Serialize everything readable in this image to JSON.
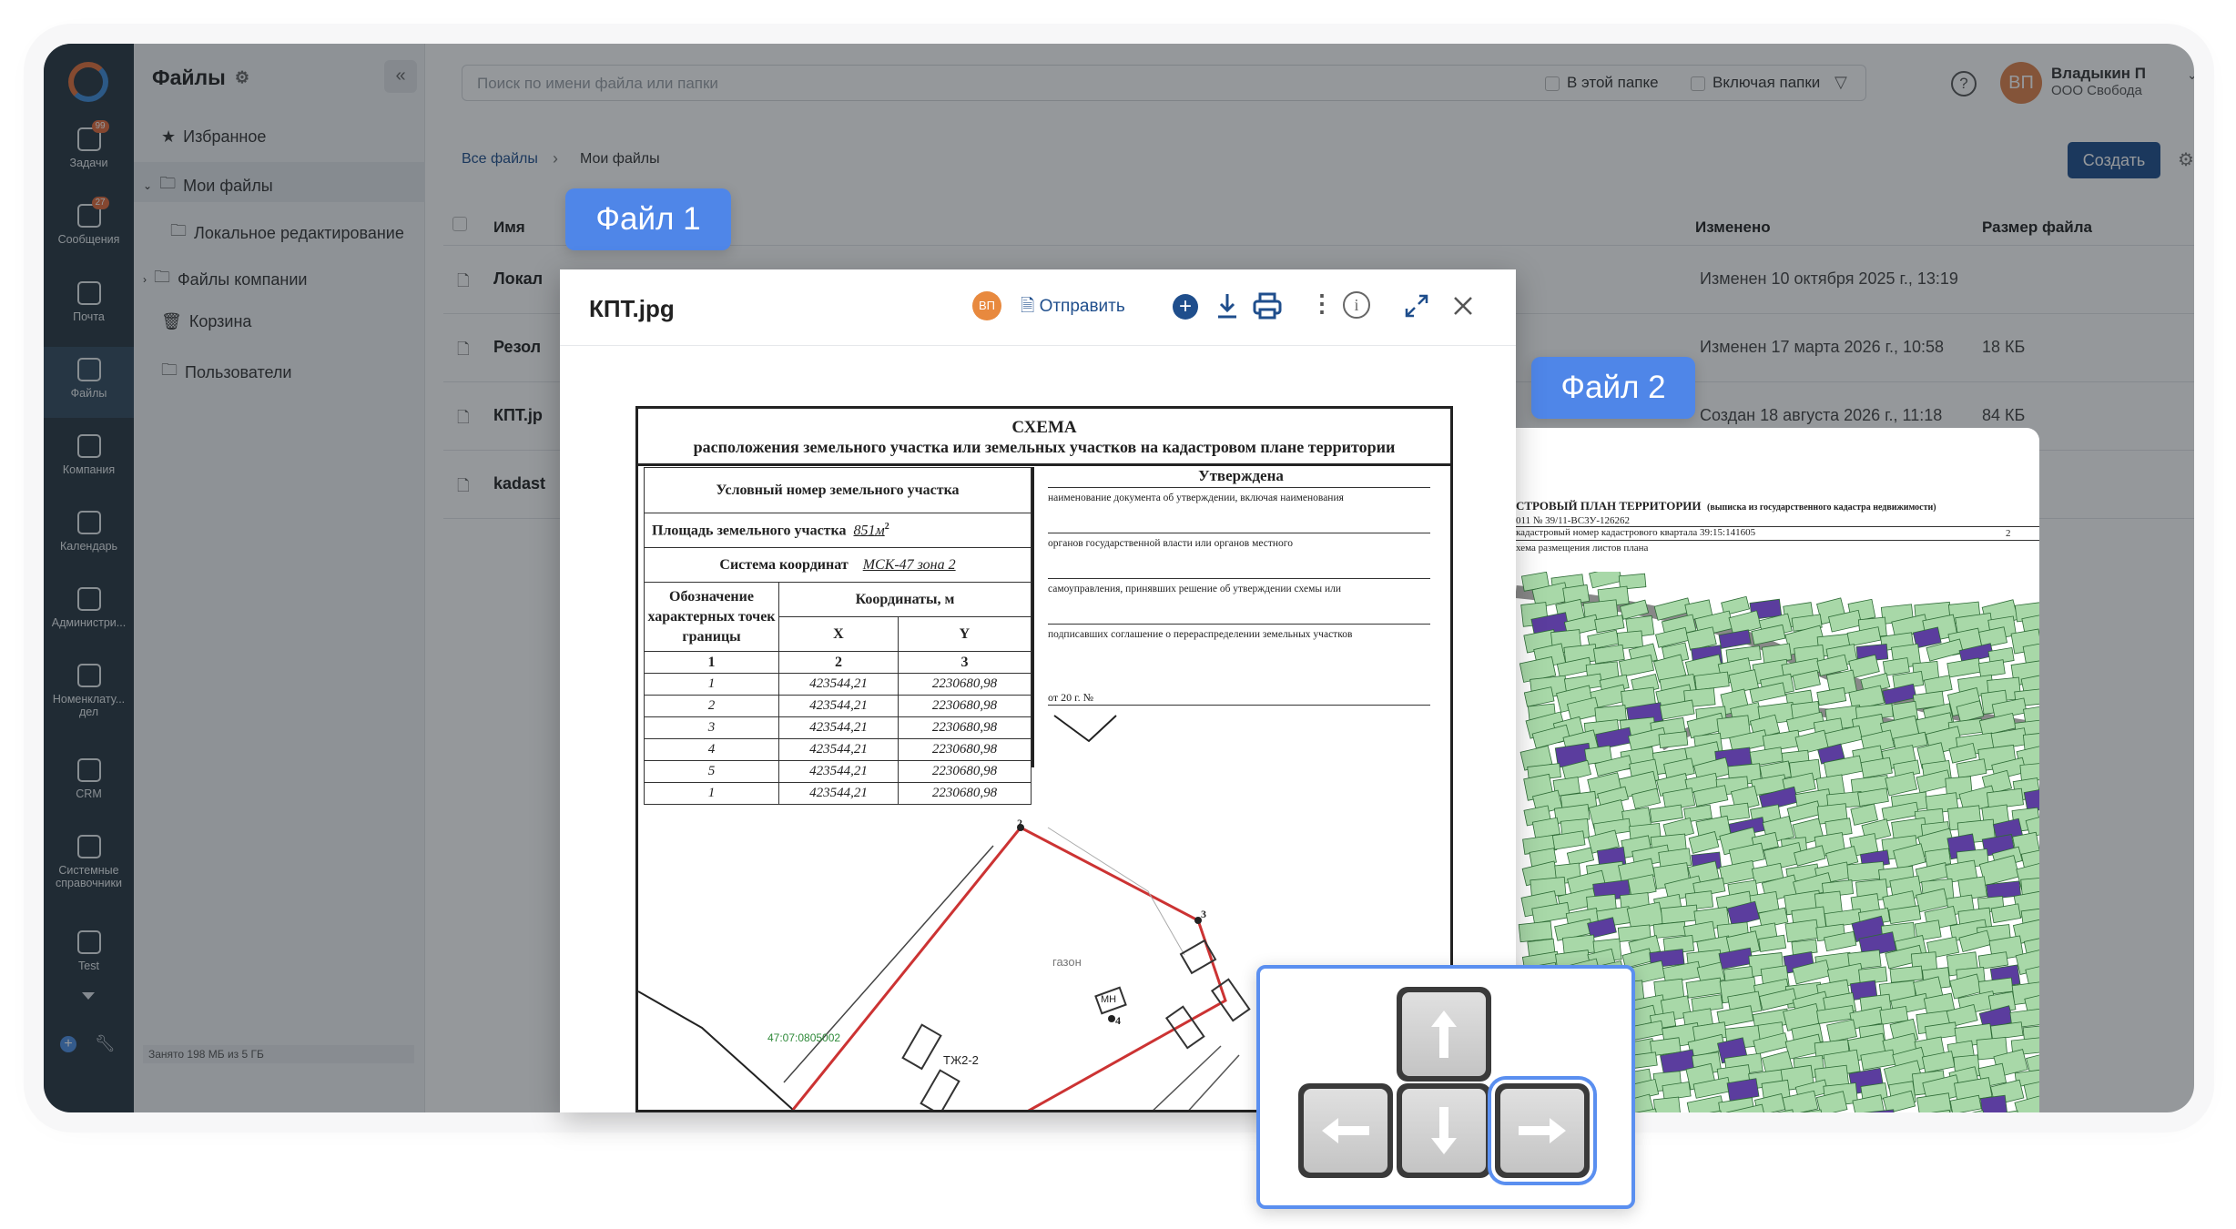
{
  "sidebar": {
    "items": [
      {
        "label": "Задачи",
        "badge": "99",
        "icon": "tasks-icon"
      },
      {
        "label": "Сообщения",
        "badge": "27",
        "icon": "messages-icon"
      },
      {
        "label": "Почта",
        "icon": "at-icon"
      },
      {
        "label": "Файлы",
        "icon": "file-icon"
      },
      {
        "label": "Компания",
        "icon": "company-icon"
      },
      {
        "label": "Календарь",
        "icon": "calendar-icon"
      },
      {
        "label": "Администри...",
        "icon": "gear-icon"
      },
      {
        "label": "Номенклату... дел",
        "icon": "document-icon"
      },
      {
        "label": "CRM",
        "icon": "contact-icon"
      },
      {
        "label": "Системные справочники",
        "icon": "document-icon"
      },
      {
        "label": "Test",
        "icon": "notebook-icon"
      }
    ]
  },
  "tree": {
    "title": "Файлы",
    "items": [
      "Избранное",
      "Мои файлы",
      "Локальное редактирование",
      "Файлы компании",
      "Корзина",
      "Пользователи"
    ],
    "storage": "Занято 198 МБ из 5 ГБ"
  },
  "header": {
    "search_placeholder": "Поиск по имени файла или папки",
    "in_folder": "В этой папке",
    "include_folders": "Включая папки",
    "user_initials": "ВП",
    "user_name": "Владыкин П",
    "user_org": "ООО Свобода"
  },
  "breadcrumb": {
    "root": "Все файлы",
    "current": "Мои файлы"
  },
  "create_label": "Создать",
  "table": {
    "columns": {
      "name": "Имя",
      "modified": "Изменено",
      "size": "Размер файла"
    },
    "rows": [
      {
        "name": "Локал",
        "modified": "Изменен 10 октября 2025 г., 13:19",
        "size": ""
      },
      {
        "name": "Резол",
        "modified": "Изменен 17 марта 2026 г., 10:58",
        "size": "18 КБ"
      },
      {
        "name": "КПТ.jp",
        "modified": "Создан 18 августа 2026 г., 11:18",
        "size": "84 КБ"
      },
      {
        "name": "kadast",
        "modified": "",
        "size": ""
      }
    ]
  },
  "callouts": {
    "file1": "Файл 1",
    "file2": "Файл 2"
  },
  "viewer": {
    "filename": "КПТ.jpg",
    "avatar": "ВП",
    "send_label": "Отправить"
  },
  "doc": {
    "title": "СХЕМА",
    "subtitle": "расположения земельного участка или земельных участков на кадастровом плане территории",
    "parcel_number_label": "Условный номер земельного участка",
    "area_label": "Площадь земельного участка",
    "area_value": "851м",
    "coord_system_label": "Система координат",
    "coord_system_value": "МСК-47 зона 2",
    "points_label": "Обозначение характерных точек границы",
    "coords_label": "Координаты, м",
    "col_x": "X",
    "col_y": "Y",
    "col_nums": [
      "1",
      "2",
      "3"
    ],
    "rows": [
      [
        "1",
        "423544,21",
        "2230680,98"
      ],
      [
        "2",
        "423544,21",
        "2230680,98"
      ],
      [
        "3",
        "423544,21",
        "2230680,98"
      ],
      [
        "4",
        "423544,21",
        "2230680,98"
      ],
      [
        "5",
        "423544,21",
        "2230680,98"
      ],
      [
        "1",
        "423544,21",
        "2230680,98"
      ]
    ],
    "approved": "Утверждена",
    "approval_lines": [
      "наименование документа об утверждении, включая наименования",
      "органов государственной власти или органов местного",
      "самоуправления, принявших решение об утверждении схемы или",
      "подписавших соглашение о перераспределении земельных участков"
    ],
    "date_line": "от                              20         г.  №",
    "plan_parcel": "47:07:0805002",
    "plan_zone": "ТЖ2-2",
    "plan_lawn": "газон",
    "plan_mh": "МН",
    "plan_p2": "2",
    "plan_p3": "3",
    "plan_p4": "4"
  },
  "file2": {
    "header1": "СТРОВЫЙ ПЛАН ТЕРРИТОРИИ",
    "header1b": "(выписка из государственного кадастра недвижимости)",
    "header2": "011 №  39/11-ВС3У-126262",
    "header3": "кадастровый номер кадастрового квартала   39:15:141605",
    "header3b": "2",
    "header4": "хема размещения листов плана"
  },
  "colors": {
    "accent": "#1f4e8c",
    "callout": "#4f86e8",
    "rail": "#283642",
    "parcel": "#9fd3a0",
    "building": "#5a3d9a"
  }
}
